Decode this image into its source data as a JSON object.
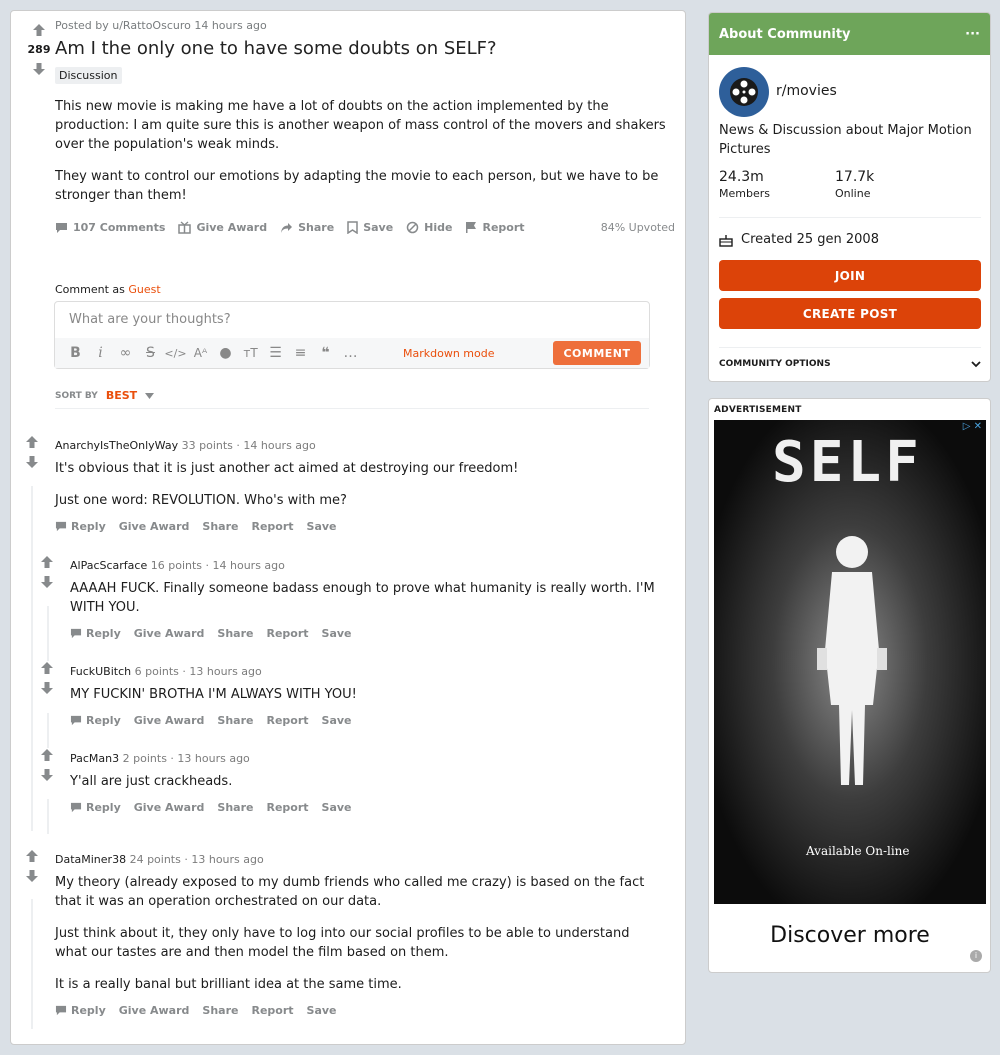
{
  "post": {
    "score": "289",
    "meta": "Posted by u/RattoOscuro 14 hours ago",
    "title": "Am I the only one to have some doubts on SELF?",
    "flair": "Discussion",
    "paragraphs": [
      "This new movie is making me have a lot of doubts on the action implemented by the production: I am quite sure this is another weapon of mass control of the movers and shakers over the population's weak minds.",
      "They want to control our emotions by adapting the movie to each person, but we have to be stronger than them!"
    ],
    "actions": {
      "comments": "107 Comments",
      "award": "Give Award",
      "share": "Share",
      "save": "Save",
      "hide": "Hide",
      "report": "Report"
    },
    "upvoted": "84% Upvoted"
  },
  "editor": {
    "comment_as_label": "Comment as",
    "comment_as_user": "Guest",
    "placeholder": "What are your thoughts?",
    "markdown": "Markdown mode",
    "submit": "COMMENT"
  },
  "sort": {
    "label": "SORT BY",
    "value": "BEST"
  },
  "comment_actions": {
    "reply": "Reply",
    "award": "Give Award",
    "share": "Share",
    "report": "Report",
    "save": "Save"
  },
  "comments": [
    {
      "user": "AnarchyIsTheOnlyWay",
      "points": "33 points",
      "time": "14 hours ago",
      "paragraphs": [
        "It's obvious that it is just another act aimed at destroying our freedom!",
        "Just one word: REVOLUTION. Who's with me?"
      ]
    },
    {
      "user": "AlPacScarface",
      "points": "16 points",
      "time": "14 hours ago",
      "paragraphs": [
        "AAAAH FUCK. Finally someone badass enough to prove what humanity is really worth. I'M WITH YOU."
      ]
    },
    {
      "user": "FuckUBitch",
      "points": "6 points",
      "time": "13 hours ago",
      "paragraphs": [
        "MY FUCKIN' BROTHA I'M ALWAYS WITH YOU!"
      ]
    },
    {
      "user": "PacMan3",
      "points": "2 points",
      "time": "13 hours ago",
      "paragraphs": [
        "Y'all are just crackheads."
      ]
    },
    {
      "user": "DataMiner38",
      "points": "24 points",
      "time": "13 hours ago",
      "paragraphs": [
        "My theory (already exposed to my dumb friends who called me crazy) is based on the fact that it was an operation orchestrated on our data.",
        "Just think about it, they only have to log into our social profiles to be able to understand what our tastes are and then model the film based on them.",
        "It is a really banal but brilliant idea at the same time."
      ]
    }
  ],
  "about": {
    "header": "About Community",
    "more": "···",
    "name": "r/movies",
    "description": "News & Discussion about Major Motion Pictures",
    "members": "24.3m",
    "members_label": "Members",
    "online": "17.7k",
    "online_label": "Online",
    "created": "Created 25 gen 2008",
    "join": "JOIN",
    "create_post": "CREATE POST",
    "options": "COMMUNITY OPTIONS",
    "header_color": "#6ea55a",
    "button_color": "#dc4309"
  },
  "ad": {
    "label": "ADVERTISEMENT",
    "poster_title": "SELF",
    "poster_tag": "Available On-line",
    "cta": "Discover more",
    "close": "▷ ✕",
    "info": "i"
  }
}
